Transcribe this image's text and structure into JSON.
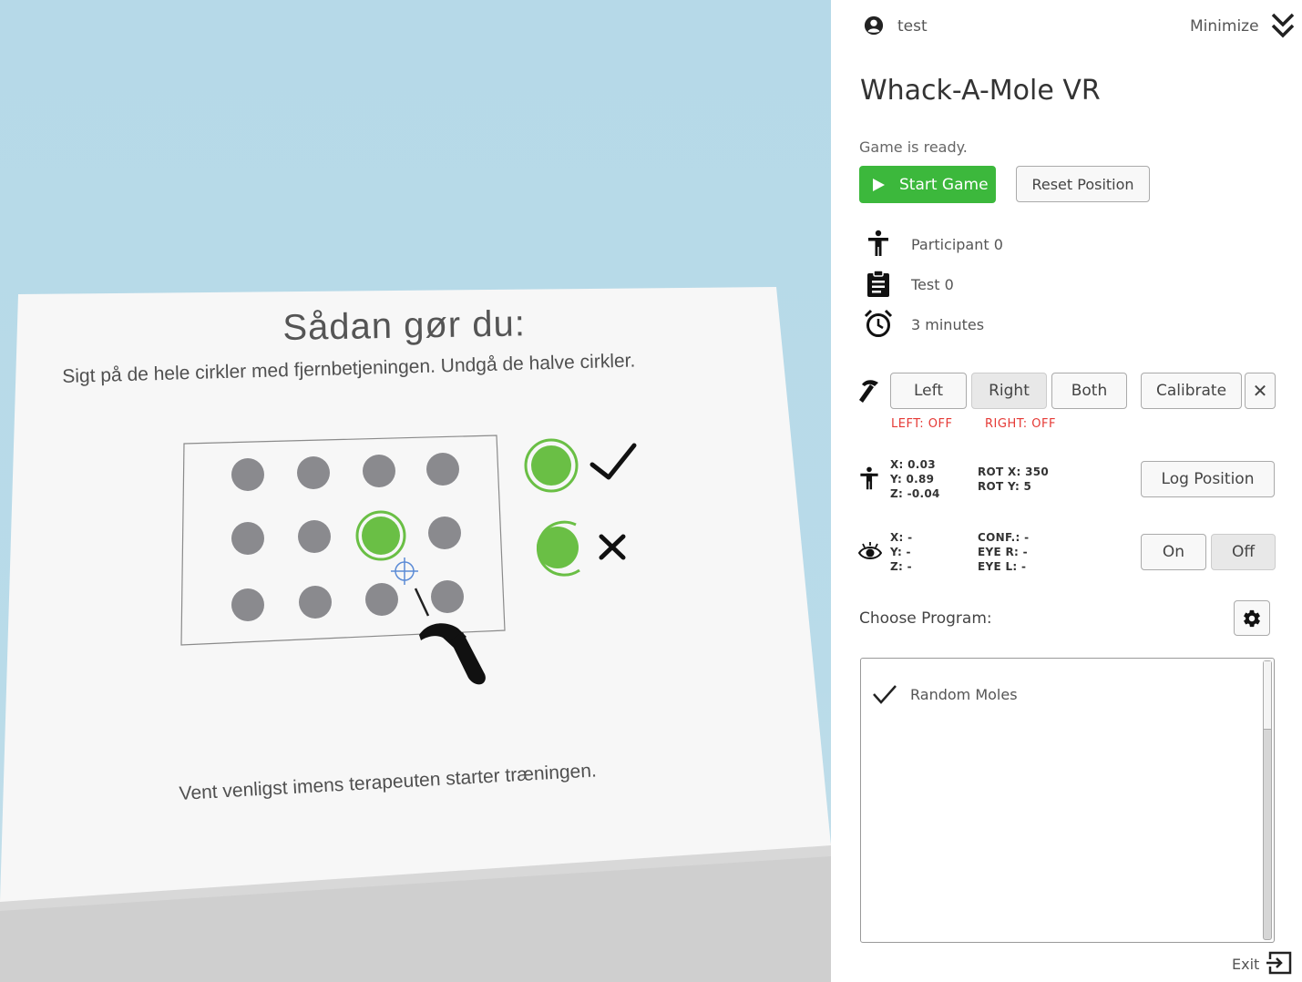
{
  "scene": {
    "board_title": "Sådan gør du:",
    "board_subtitle": "Sigt på de hele cirkler med fjernbetjeningen. Undgå de halve cirkler.",
    "board_wait": "Vent venligst imens terapeuten starter træningen."
  },
  "header": {
    "user_icon": "account-circle-icon",
    "user_name": "test",
    "minimize_label": "Minimize",
    "minimize_icon": "double-chevron-down-icon"
  },
  "title": "Whack-A-Mole VR",
  "status": "Game is ready.",
  "actions": {
    "start_label": "Start Game",
    "reset_label": "Reset Position"
  },
  "session": {
    "participant": "Participant 0",
    "test": "Test 0",
    "duration": "3 minutes"
  },
  "controllers": {
    "left_label": "Left",
    "right_label": "Right",
    "both_label": "Both",
    "calibrate_label": "Calibrate",
    "close_label": "✕",
    "left_status": "LEFT: OFF",
    "right_status": "RIGHT: OFF"
  },
  "head_tracking": {
    "x": "X: 0.03",
    "y": "Y: 0.89",
    "z": "Z: -0.04",
    "rot_x": "ROT X: 350",
    "rot_y": "ROT Y: 5",
    "log_label": "Log Position"
  },
  "eye_tracking": {
    "x": "X: -",
    "y": "Y: -",
    "z": "Z: -",
    "conf": "CONF.: -",
    "eye_r": "EYE R: -",
    "eye_l": "EYE L: -",
    "on_label": "On",
    "off_label": "Off"
  },
  "program": {
    "choose_label": "Choose Program:",
    "items": [
      {
        "label": "Random Moles",
        "selected": true
      }
    ]
  },
  "footer": {
    "exit_label": "Exit"
  },
  "colors": {
    "accent_green": "#3cb83c",
    "mole_green": "#6abf45",
    "mole_gray": "#8a8a8e",
    "status_red": "#e53935",
    "sky": "#b6d9e8"
  }
}
